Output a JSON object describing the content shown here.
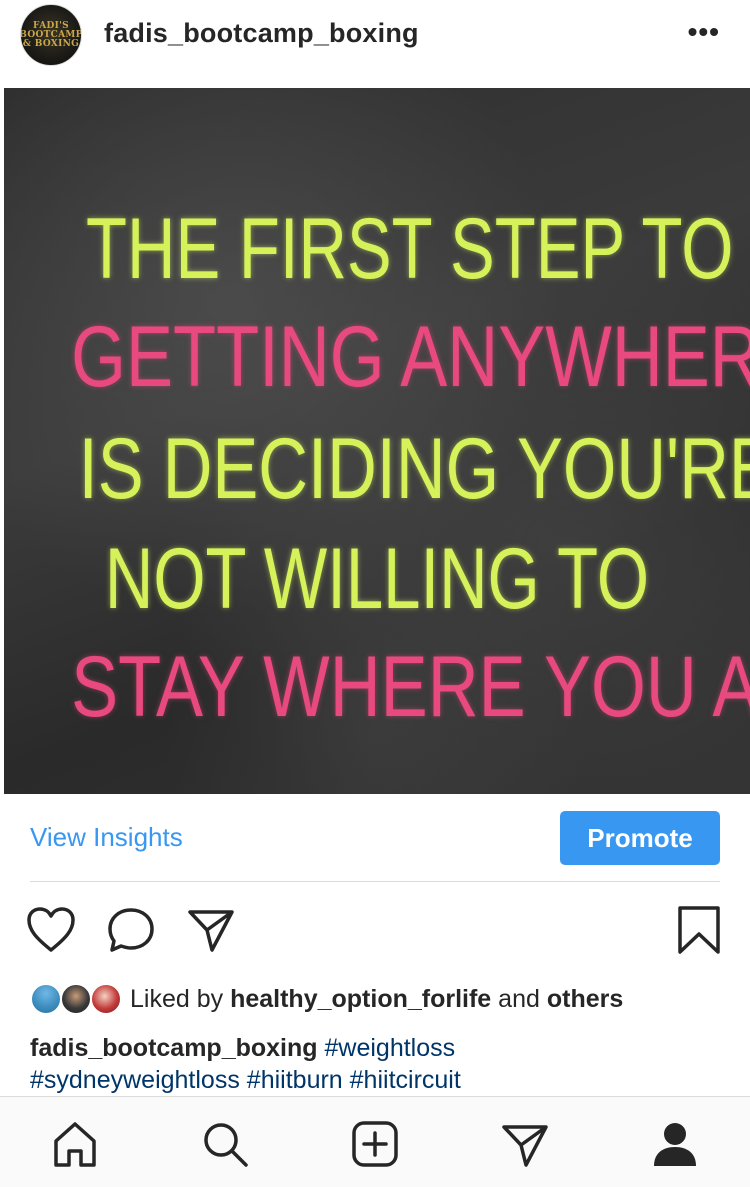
{
  "header": {
    "username": "fadis_bootcamp_boxing",
    "avatar_logo_text": "FADI'S BOOTCAMP & BOXING",
    "more_label": "•••"
  },
  "post": {
    "quote_lines": [
      {
        "text": "THE FIRST STEP TO",
        "color": "yellow"
      },
      {
        "text": "GETTING ANYWHERE",
        "color": "pink"
      },
      {
        "text": "IS DECIDING YOU'RE",
        "color": "yellow"
      },
      {
        "text": "NOT WILLING TO",
        "color": "yellow"
      },
      {
        "text": "STAY WHERE YOU ARE.",
        "color": "pink"
      }
    ]
  },
  "actions": {
    "insights_label": "View Insights",
    "promote_label": "Promote",
    "icons": [
      "heart-icon",
      "comment-icon",
      "share-icon",
      "bookmark-icon"
    ]
  },
  "likes": {
    "prefix": "Liked by",
    "user": "healthy_option_forlife",
    "joiner": "and",
    "suffix": "others"
  },
  "caption": {
    "author": "fadis_bootcamp_boxing",
    "hashtags": [
      "#weightloss",
      "#sydneyweightloss",
      "#hiitburn",
      "#hiitcircuit"
    ]
  },
  "bottom_nav": {
    "items": [
      "home-icon",
      "search-icon",
      "new-post-icon",
      "activity-icon",
      "profile-icon"
    ]
  },
  "colors": {
    "accent": "#3897f0",
    "hashtag": "#003569",
    "quote_yellow": "#d6f25a",
    "quote_pink": "#e8497e"
  }
}
